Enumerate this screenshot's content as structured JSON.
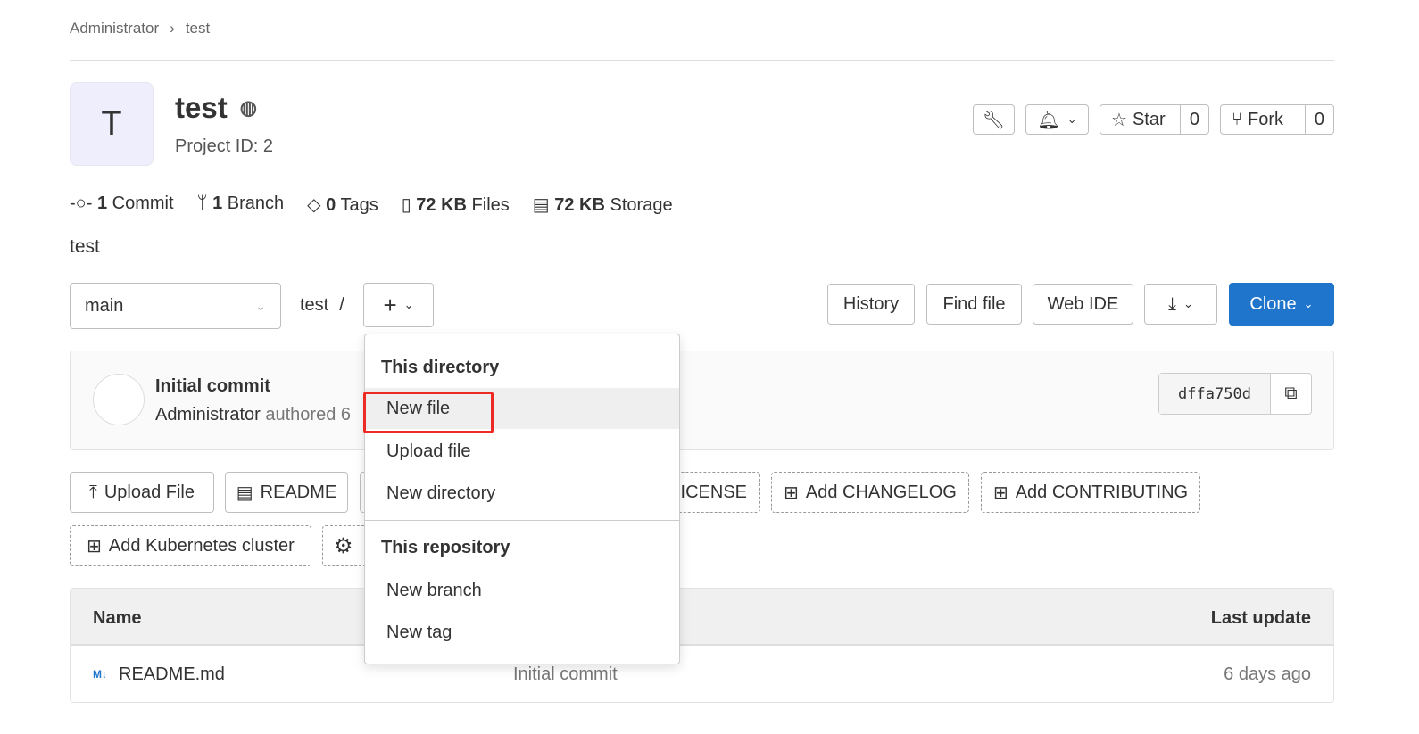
{
  "breadcrumb": {
    "items": [
      "Administrator",
      "test"
    ]
  },
  "project": {
    "avatar_letter": "T",
    "name": "test",
    "id_label": "Project ID: 2",
    "description": "test"
  },
  "header_actions": {
    "star_label": "Star",
    "star_count": "0",
    "fork_label": "Fork",
    "fork_count": "0"
  },
  "stats": [
    {
      "value": "1",
      "label": "Commit"
    },
    {
      "value": "1",
      "label": "Branch"
    },
    {
      "value": "0",
      "label": "Tags"
    },
    {
      "value": "72 KB",
      "label": "Files"
    },
    {
      "value": "72 KB",
      "label": "Storage"
    }
  ],
  "toolbar": {
    "branch": "main",
    "path": "test",
    "path_sep": "/",
    "history": "History",
    "find_file": "Find file",
    "web_ide": "Web IDE",
    "clone": "Clone"
  },
  "commit": {
    "title": "Initial commit",
    "author": "Administrator",
    "authored": "authored 6",
    "sha": "dffa750d"
  },
  "quick_actions": [
    "Upload File",
    "README",
    "",
    "Add LICENSE",
    "Add CHANGELOG",
    "Add CONTRIBUTING",
    "Add Kubernetes cluster",
    ""
  ],
  "dropdown": {
    "section1": "This directory",
    "items1": [
      "New file",
      "Upload file",
      "New directory"
    ],
    "section2": "This repository",
    "items2": [
      "New branch",
      "New tag"
    ]
  },
  "table": {
    "headers": [
      "Name",
      "Last update"
    ],
    "rows": [
      {
        "name": "README.md",
        "commit": "Initial commit",
        "updated": "6 days ago"
      }
    ]
  },
  "colors": {
    "primary": "#1f75cb",
    "highlight": "#ee2a24"
  }
}
